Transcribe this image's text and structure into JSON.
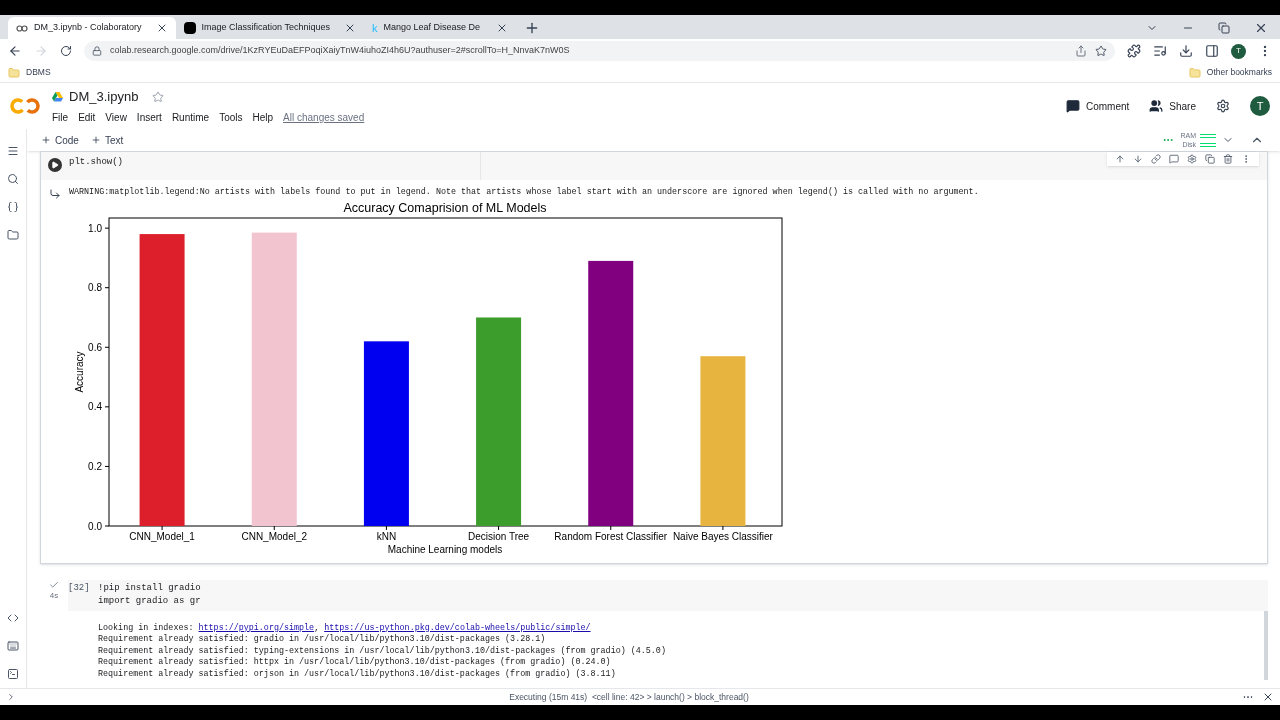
{
  "browser": {
    "tabs": [
      {
        "title": "DM_3.ipynb - Colaboratory",
        "selected": true
      },
      {
        "title": "Image Classification Techniques",
        "selected": false
      },
      {
        "title": "Mango Leaf Disease De",
        "selected": false,
        "favicon": "k"
      }
    ],
    "url": "colab.research.google.com/drive/1KzRYEuDaEFPoqiXaiyTnW4iuhoZI4h6U?authuser=2#scrollTo=H_NnvaK7nW0S",
    "bookmarks": [
      "DBMS"
    ],
    "other_bookmarks": "Other bookmarks",
    "profile": "T"
  },
  "notebook": {
    "title": "DM_3.ipynb",
    "menu": [
      "File",
      "Edit",
      "View",
      "Insert",
      "Runtime",
      "Tools",
      "Help"
    ],
    "save_status": "All changes saved",
    "actions": [
      "Comment",
      "Share"
    ],
    "avatar": "T",
    "toolbar": [
      "Code",
      "Text"
    ],
    "resources": [
      "RAM",
      "Disk"
    ]
  },
  "cells": [
    {
      "code": [
        "plt.show()"
      ],
      "warning": "WARNING:matplotlib.legend:No artists with labels found to put in legend.  Note that artists whose label start with an underscore are ignored when legend() is called with no argument.",
      "chart_data": {
        "type": "bar",
        "title": "Accuracy Comaprision of ML Models",
        "xlabel": "Machine Learning models",
        "ylabel": "Accuracy",
        "categories": [
          "CNN_Model_1",
          "CNN_Model_2",
          "kNN",
          "Decision Tree",
          "Random Forest Classifier",
          "Naive Bayes Classifier"
        ],
        "values": [
          0.98,
          0.985,
          0.62,
          0.7,
          0.89,
          0.57
        ],
        "colors": [
          "#dc1f2a",
          "#f2c4d0",
          "#0000f0",
          "#3c9c2c",
          "#800080",
          "#e8b440"
        ],
        "ylim": [
          0,
          1.034
        ],
        "yticks": [
          {
            "value": 0,
            "label": "0.0"
          },
          0.2,
          0.4,
          0.6,
          0.8,
          {
            "value": 1,
            "label": "1.0"
          }
        ]
      }
    },
    {
      "count": "[32]",
      "run_time": "4s",
      "code": [
        "!pip install gradio",
        "import gradio as gr"
      ],
      "output": [
        {
          "kind": "links",
          "text": "Looking in indexes: ",
          "links": [
            "https://pypi.org/simple",
            "https://us-python.pkg.dev/colab-wheels/public/simple/"
          ],
          "separator": ","
        },
        {
          "kind": "line",
          "text": "Requirement already satisfied: gradio in /usr/local/lib/python3.10/dist-packages (3.28.1)"
        },
        {
          "kind": "line",
          "text": "Requirement already satisfied: typing-extensions in /usr/local/lib/python3.10/dist-packages (from gradio) (4.5.0)"
        },
        {
          "kind": "line",
          "text": "Requirement already satisfied: httpx in /usr/local/lib/python3.10/dist-packages (from gradio) (0.24.0)"
        },
        {
          "kind": "line",
          "text": "Requirement already satisfied: orjson in /usr/local/lib/python3.10/dist-packages (from gradio) (3.8.11)"
        }
      ]
    }
  ],
  "status_bar": "Executing (15m 41s)  <cell line: 42> > launch() > block_thread()"
}
